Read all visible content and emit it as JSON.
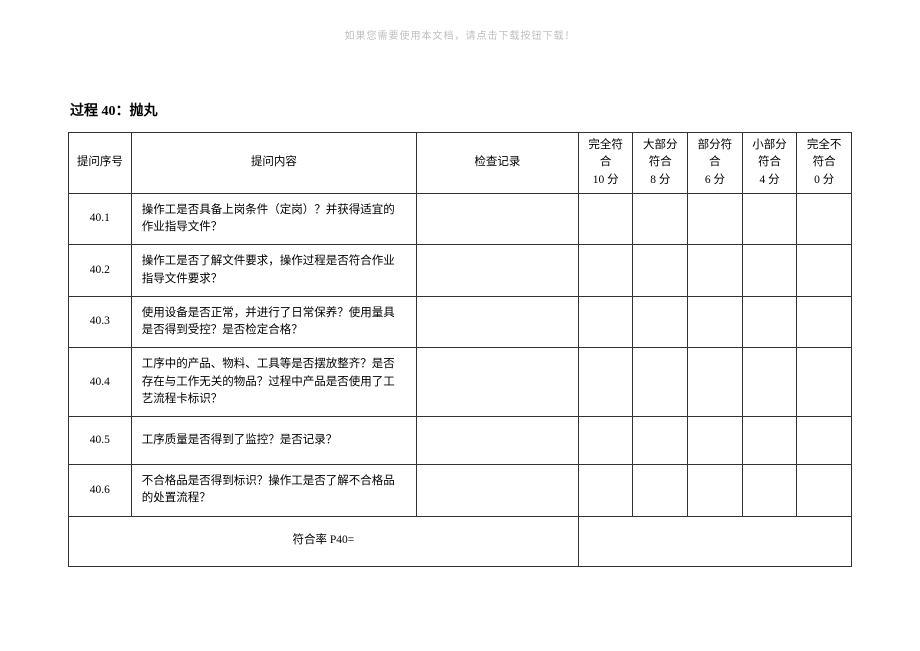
{
  "watermark": "如果您需要使用本文档，请点击下载按钮下载！",
  "title": "过程 40：抛丸",
  "headers": {
    "seq": "提问序号",
    "question": "提问内容",
    "record": "检查记录",
    "scores": [
      {
        "label": "完全符合",
        "points": "10 分"
      },
      {
        "label": "大部分符合",
        "points": "8 分"
      },
      {
        "label": "部分符合",
        "points": "6 分"
      },
      {
        "label": "小部分符合",
        "points": "4 分"
      },
      {
        "label": "完全不符合",
        "points": "0 分"
      }
    ]
  },
  "rows": [
    {
      "seq": "40.1",
      "question": "操作工是否具备上岗条件（定岗）？并获得适宜的作业指导文件？"
    },
    {
      "seq": "40.2",
      "question": "操作工是否了解文件要求，操作过程是否符合作业指导文件要求？"
    },
    {
      "seq": "40.3",
      "question": "使用设备是否正常，并进行了日常保养？使用量具是否得到受控？是否检定合格？"
    },
    {
      "seq": "40.4",
      "question": "工序中的产品、物料、工具等是否摆放整齐？是否存在与工作无关的物品？过程中产品是否使用了工艺流程卡标识？"
    },
    {
      "seq": "40.5",
      "question": "工序质量是否得到了监控？是否记录？"
    },
    {
      "seq": "40.6",
      "question": "不合格品是否得到标识？操作工是否了解不合格品的处置流程？"
    }
  ],
  "footer": "符合率  P40="
}
